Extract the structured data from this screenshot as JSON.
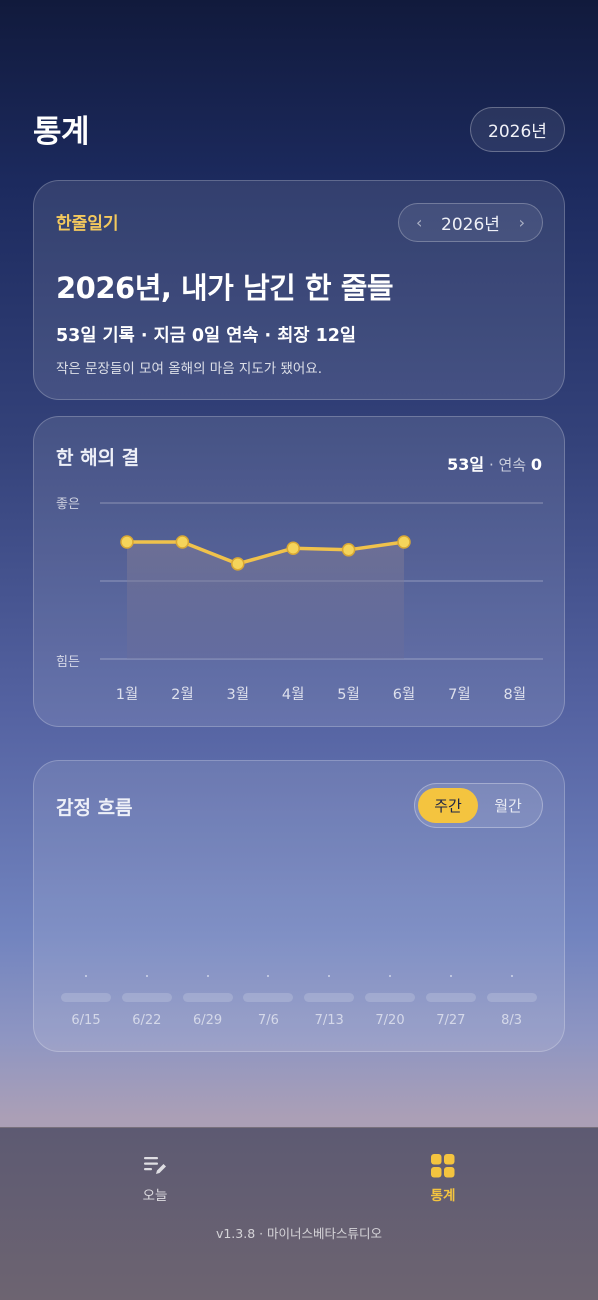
{
  "header": {
    "title": "통계",
    "year_button": "2026년"
  },
  "summary_card": {
    "label": "한줄일기",
    "year": "2026년",
    "prev_icon": "chevron-left-icon",
    "next_icon": "chevron-right-icon",
    "headline": "2026년, 내가 남긴 한 줄들",
    "stats_line": "53일 기록 · 지금 0일 연속 · 최장 12일",
    "description": "작은 문장들이 모여 올해의 마음 지도가 됐어요."
  },
  "year_card": {
    "title": "한 해의 결",
    "days": "53일",
    "streak_label": "· 연속",
    "streak": "0"
  },
  "chart_data": {
    "type": "area",
    "categories": [
      "1월",
      "2월",
      "3월",
      "4월",
      "5월",
      "6월",
      "7월",
      "8월"
    ],
    "values": [
      0.75,
      0.75,
      0.61,
      0.71,
      0.7,
      0.75,
      null,
      null
    ],
    "ylim": [
      0,
      1
    ],
    "y_tick_labels": {
      "top": "좋은",
      "bottom": "힘든"
    },
    "grid": true,
    "colors": {
      "line": "#f0c24b",
      "point": "#f5d45b",
      "fill": "rgba(120,120,150,0.35)"
    }
  },
  "emotion_card": {
    "title": "감정 흐름",
    "toggle": {
      "weekly": "주간",
      "monthly": "월간",
      "selected": "weekly"
    },
    "weeks": [
      "6/15",
      "6/22",
      "6/29",
      "7/6",
      "7/13",
      "7/20",
      "7/27",
      "8/3"
    ]
  },
  "bottom_nav": {
    "today": {
      "label": "오늘",
      "icon": "edit-list-icon"
    },
    "stats": {
      "label": "통계",
      "icon": "grid-icon",
      "active": true
    },
    "version": "v1.3.8 · 마이너스베타스튜디오"
  }
}
